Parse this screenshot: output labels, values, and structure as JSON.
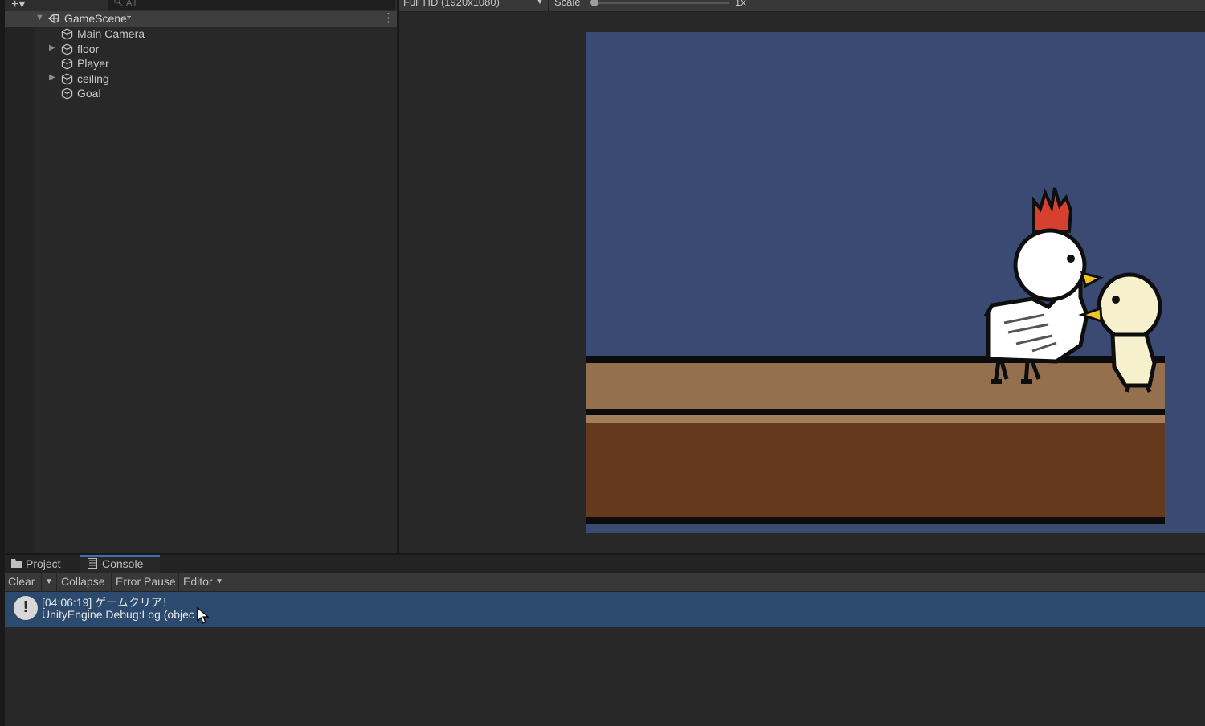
{
  "hierarchy": {
    "search_placeholder": "All",
    "scene_name": "GameScene*",
    "items": [
      {
        "label": "Main Camera",
        "expandable": false
      },
      {
        "label": "floor",
        "expandable": true
      },
      {
        "label": "Player",
        "expandable": false
      },
      {
        "label": "ceiling",
        "expandable": true
      },
      {
        "label": "Goal",
        "expandable": false
      }
    ]
  },
  "game_view": {
    "resolution": "Full HD (1920x1080)",
    "scale_label": "Scale",
    "scale_value": "1x",
    "sky_color": "#3a4a72",
    "floor_top_color": "#95704f",
    "floor_bottom_color": "#65391d"
  },
  "bottom_tabs": {
    "project": "Project",
    "console": "Console"
  },
  "console": {
    "toolbar": {
      "clear": "Clear",
      "collapse": "Collapse",
      "error_pause": "Error Pause",
      "editor": "Editor"
    },
    "entries": [
      {
        "type": "info",
        "line1": "[04:06:19] ゲームクリア！",
        "line2": "UnityEngine.Debug:Log (objec"
      }
    ]
  }
}
